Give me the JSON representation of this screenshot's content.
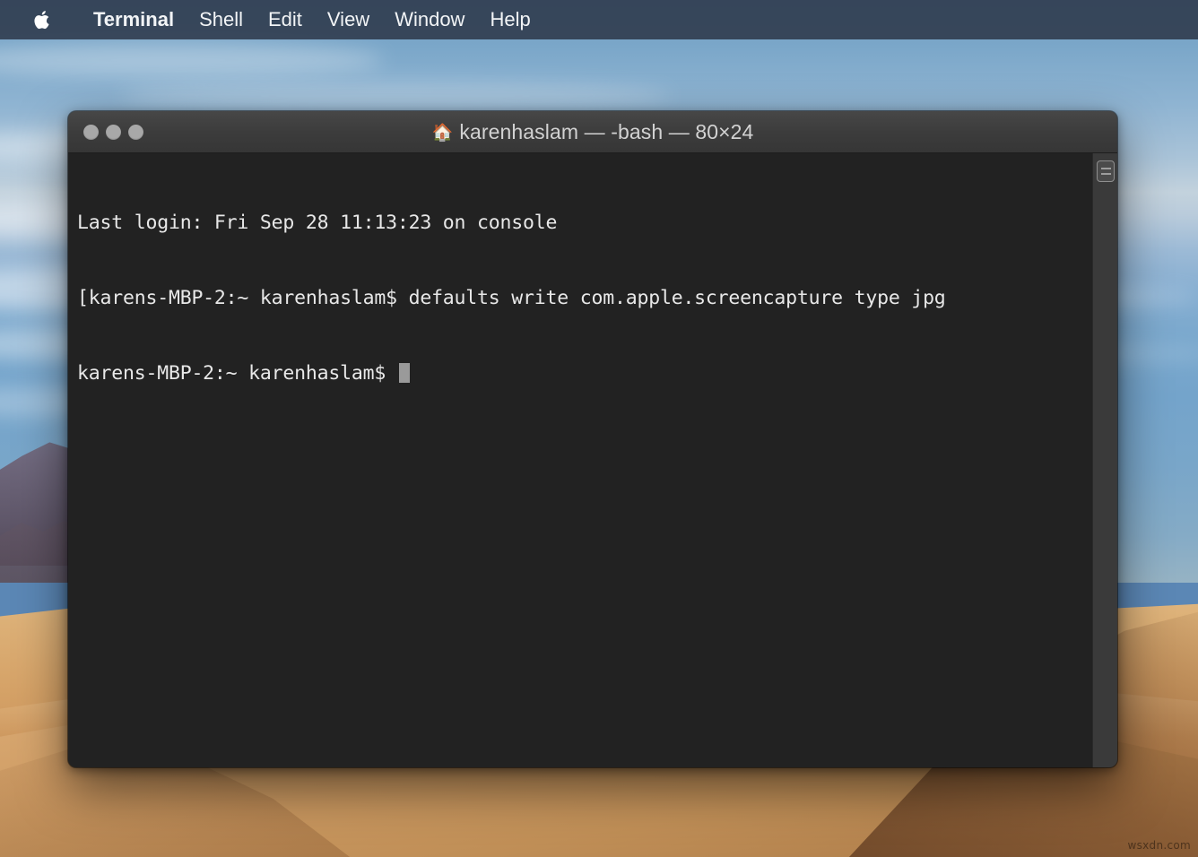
{
  "menubar": {
    "apple_icon": "apple-logo-icon",
    "items": [
      {
        "label": "Terminal",
        "active": true
      },
      {
        "label": "Shell",
        "active": false
      },
      {
        "label": "Edit",
        "active": false
      },
      {
        "label": "View",
        "active": false
      },
      {
        "label": "Window",
        "active": false
      },
      {
        "label": "Help",
        "active": false
      }
    ]
  },
  "window": {
    "home_icon": "🏠",
    "title": "karenhaslam — -bash — 80×24",
    "user": "karenhaslam",
    "shell": "-bash",
    "size": "80×24",
    "traffic_lights": [
      {
        "name": "close-button",
        "color": "#a8a8a8"
      },
      {
        "name": "minimize-button",
        "color": "#a8a8a8"
      },
      {
        "name": "maximize-button",
        "color": "#a8a8a8"
      }
    ],
    "titlebar_color": "#3c3c3c",
    "background_color": "#222222",
    "text_color": "#e8e8e8"
  },
  "terminal": {
    "line1": "Last login: Fri Sep 28 11:13:23 on console",
    "line2": "[karens-MBP-2:~ karenhaslam$ defaults write com.apple.screencapture type jpg",
    "line2_right_bracket": "]",
    "line3": "karens-MBP-2:~ karenhaslam$ ",
    "login_message": "Last login: Fri Sep 28 11:13:23 on console",
    "prompt": "karens-MBP-2:~ karenhaslam$",
    "command": "defaults write com.apple.screencapture type jpg",
    "hostname": "karens-MBP-2",
    "cwd": "~",
    "cursor": "block-cursor"
  },
  "scrollbar": {
    "thumb_icon": "scrollbar-thumb-icon"
  },
  "desktop": {
    "wallpaper_name": "mojave-desert",
    "watermark": "wsxdn.com",
    "sky_color": "#7aa8cd",
    "sand_color": "#d5a267"
  }
}
